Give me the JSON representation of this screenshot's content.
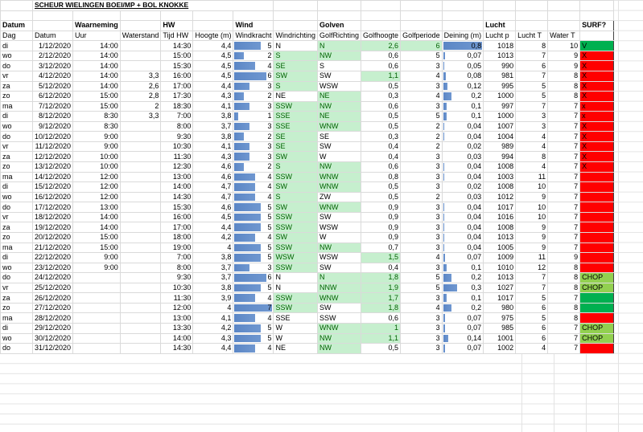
{
  "title": "SCHEUR WIELINGEN BOEI/MP + BOL KNOKKE",
  "groups": {
    "datum": "Datum",
    "waarneming": "Waarneming",
    "hw": "HW",
    "wind": "Wind",
    "golven": "Golven",
    "lucht": "Lucht",
    "surf": "SURF?"
  },
  "headers": [
    "Dag",
    "Datum",
    "Uur",
    "Waterstand",
    "Tijd HW",
    "Hoogte (m)",
    "Windkracht",
    "Windrichting",
    "GolfRichting",
    "Golfhoogte",
    "Golfperiode",
    "Deining (m)",
    "Lucht p",
    "Lucht T",
    "Water T",
    ""
  ],
  "colors": {
    "bar": "#638ec6",
    "highlight_bg": "#c6efce",
    "highlight_text": "#006100",
    "surf_yes": "#00b050",
    "surf_no": "#ff0000",
    "surf_chop": "#92d050"
  },
  "rows": [
    {
      "c": [
        "di",
        "1/12/2020",
        "14:00",
        "",
        "14:30",
        "4,4",
        "5",
        "N",
        "N",
        "2,6",
        "6",
        "0,8",
        "1018",
        "8",
        "10",
        "V"
      ],
      "hl": [
        8,
        9,
        10
      ],
      "s": "yes"
    },
    {
      "c": [
        "wo",
        "2/12/2020",
        "14:00",
        "",
        "15:00",
        "4,5",
        "2",
        "S",
        "NW",
        "0,6",
        "5",
        "0,07",
        "1013",
        "7",
        "9",
        "X"
      ],
      "hl": [
        7,
        8
      ],
      "s": "no"
    },
    {
      "c": [
        "do",
        "3/12/2020",
        "14:00",
        "",
        "15:30",
        "4,5",
        "4",
        "SE",
        "S",
        "0,6",
        "3",
        "0,05",
        "990",
        "6",
        "9",
        "X"
      ],
      "hl": [
        7
      ],
      "s": "no"
    },
    {
      "c": [
        "vr",
        "4/12/2020",
        "14:00",
        "3,3",
        "16:00",
        "4,5",
        "6",
        "SW",
        "SW",
        "1,1",
        "4",
        "0,08",
        "981",
        "7",
        "8",
        "X"
      ],
      "hl": [
        7,
        9
      ],
      "s": "no"
    },
    {
      "c": [
        "za",
        "5/12/2020",
        "14:00",
        "2,6",
        "17:00",
        "4,4",
        "3",
        "S",
        "WSW",
        "0,5",
        "3",
        "0,12",
        "995",
        "5",
        "8",
        "X"
      ],
      "hl": [
        7
      ],
      "s": "no"
    },
    {
      "c": [
        "zo",
        "6/12/2020",
        "15:00",
        "2,8",
        "17:30",
        "4,3",
        "2",
        "NE",
        "NE",
        "0,3",
        "4",
        "0,2",
        "1000",
        "5",
        "8",
        "X"
      ],
      "hl": [
        8
      ],
      "s": "no"
    },
    {
      "c": [
        "ma",
        "7/12/2020",
        "15:00",
        "2",
        "18:30",
        "4,1",
        "3",
        "SSW",
        "NW",
        "0,6",
        "3",
        "0,1",
        "997",
        "7",
        "7",
        "x"
      ],
      "hl": [
        7,
        8
      ],
      "s": "no"
    },
    {
      "c": [
        "di",
        "8/12/2020",
        "8:30",
        "3,3",
        "7:00",
        "3,8",
        "1",
        "SSE",
        "NE",
        "0,5",
        "5",
        "0,1",
        "1000",
        "3",
        "7",
        "x"
      ],
      "hl": [
        7,
        8
      ],
      "s": "no"
    },
    {
      "c": [
        "wo",
        "9/12/2020",
        "8:30",
        "",
        "8:00",
        "3,7",
        "3",
        "SSE",
        "WNW",
        "0,5",
        "2",
        "0,04",
        "1007",
        "3",
        "7",
        "X"
      ],
      "hl": [
        7,
        8
      ],
      "s": "no"
    },
    {
      "c": [
        "do",
        "10/12/2020",
        "9:00",
        "",
        "9:30",
        "3,8",
        "2",
        "SE",
        "SE",
        "0,3",
        "2",
        "0,04",
        "1004",
        "4",
        "7",
        "X"
      ],
      "hl": [
        7
      ],
      "s": "no"
    },
    {
      "c": [
        "vr",
        "11/12/2020",
        "9:00",
        "",
        "10:30",
        "4,1",
        "3",
        "SE",
        "SW",
        "0,4",
        "2",
        "0,02",
        "989",
        "4",
        "7",
        "X"
      ],
      "hl": [
        7
      ],
      "s": "no"
    },
    {
      "c": [
        "za",
        "12/12/2020",
        "10:00",
        "",
        "11:30",
        "4,3",
        "3",
        "SW",
        "W",
        "0,4",
        "3",
        "0,03",
        "994",
        "8",
        "7",
        "X"
      ],
      "hl": [
        7
      ],
      "s": "no"
    },
    {
      "c": [
        "zo",
        "13/12/2020",
        "10:00",
        "",
        "12:30",
        "4,6",
        "2",
        "S",
        "NW",
        "0,6",
        "3",
        "0,04",
        "1008",
        "4",
        "7",
        "X"
      ],
      "hl": [
        7,
        8
      ],
      "s": "no"
    },
    {
      "c": [
        "ma",
        "14/12/2020",
        "12:00",
        "",
        "13:00",
        "4,6",
        "4",
        "SSW",
        "WNW",
        "0,8",
        "3",
        "0,04",
        "1003",
        "11",
        "7",
        ""
      ],
      "hl": [
        7,
        8
      ],
      "s": "no"
    },
    {
      "c": [
        "di",
        "15/12/2020",
        "12:00",
        "",
        "14:00",
        "4,7",
        "4",
        "SW",
        "WNW",
        "0,5",
        "3",
        "0,02",
        "1008",
        "10",
        "7",
        ""
      ],
      "hl": [
        7,
        8
      ],
      "s": "no"
    },
    {
      "c": [
        "wo",
        "16/12/2020",
        "12:00",
        "",
        "14:30",
        "4,7",
        "4",
        "S",
        "ZW",
        "0,5",
        "2",
        "0,03",
        "1012",
        "9",
        "7",
        ""
      ],
      "hl": [
        7
      ],
      "s": "no"
    },
    {
      "c": [
        "do",
        "17/12/2020",
        "13:00",
        "",
        "15:30",
        "4,6",
        "5",
        "SW",
        "WNW",
        "0,9",
        "3",
        "0,04",
        "1017",
        "10",
        "7",
        ""
      ],
      "hl": [
        7,
        8
      ],
      "s": "no"
    },
    {
      "c": [
        "vr",
        "18/12/2020",
        "14:00",
        "",
        "16:00",
        "4,5",
        "5",
        "SSW",
        "SW",
        "0,9",
        "3",
        "0,04",
        "1016",
        "10",
        "7",
        ""
      ],
      "hl": [
        7
      ],
      "s": "no"
    },
    {
      "c": [
        "za",
        "19/12/2020",
        "14:00",
        "",
        "17:00",
        "4,4",
        "5",
        "SSW",
        "WSW",
        "0,9",
        "3",
        "0,04",
        "1008",
        "9",
        "7",
        ""
      ],
      "hl": [
        7
      ],
      "s": "no"
    },
    {
      "c": [
        "zo",
        "20/12/2020",
        "15:00",
        "",
        "18:00",
        "4,2",
        "4",
        "SW",
        "W",
        "0,9",
        "3",
        "0,04",
        "1013",
        "9",
        "7",
        ""
      ],
      "hl": [
        7
      ],
      "s": "no"
    },
    {
      "c": [
        "ma",
        "21/12/2020",
        "15:00",
        "",
        "19:00",
        "4",
        "5",
        "SSW",
        "NW",
        "0,7",
        "3",
        "0,04",
        "1005",
        "9",
        "7",
        ""
      ],
      "hl": [
        7,
        8
      ],
      "s": "no"
    },
    {
      "c": [
        "di",
        "22/12/2020",
        "9:00",
        "",
        "7:00",
        "3,8",
        "5",
        "WSW",
        "WSW",
        "1,5",
        "4",
        "0,07",
        "1009",
        "11",
        "9",
        ""
      ],
      "hl": [
        7,
        9
      ],
      "s": "no"
    },
    {
      "c": [
        "wo",
        "23/12/2020",
        "9:00",
        "",
        "8:00",
        "3,7",
        "3",
        "SSW",
        "SW",
        "0,4",
        "3",
        "0,1",
        "1010",
        "12",
        "8",
        ""
      ],
      "hl": [
        7
      ],
      "s": "no"
    },
    {
      "c": [
        "do",
        "24/12/2020",
        "",
        "",
        "9:30",
        "3,7",
        "6",
        "N",
        "N",
        "1,8",
        "5",
        "0,2",
        "1013",
        "7",
        "8",
        "CHOP"
      ],
      "hl": [
        8,
        9
      ],
      "s": "chop"
    },
    {
      "c": [
        "vr",
        "25/12/2020",
        "",
        "",
        "10:30",
        "3,8",
        "5",
        "N",
        "NNW",
        "1,9",
        "5",
        "0,3",
        "1027",
        "7",
        "8",
        "CHOP"
      ],
      "hl": [
        8,
        9
      ],
      "s": "chop"
    },
    {
      "c": [
        "za",
        "26/12/2020",
        "",
        "",
        "11:30",
        "3,9",
        "4",
        "SSW",
        "WNW",
        "1,7",
        "3",
        "0,1",
        "1017",
        "5",
        "7",
        ""
      ],
      "hl": [
        7,
        8,
        9
      ],
      "s": "yes"
    },
    {
      "c": [
        "zo",
        "27/12/2020",
        "",
        "",
        "12:00",
        "4",
        "7",
        "SSW",
        "SW",
        "1,8",
        "4",
        "0,2",
        "980",
        "6",
        "8",
        ""
      ],
      "hl": [
        7,
        9
      ],
      "s": "yes"
    },
    {
      "c": [
        "ma",
        "28/12/2020",
        "",
        "",
        "13:00",
        "4,1",
        "4",
        "SSE",
        "SSW",
        "0,6",
        "3",
        "0,07",
        "975",
        "5",
        "8",
        ""
      ],
      "hl": [],
      "s": "no"
    },
    {
      "c": [
        "di",
        "29/12/2020",
        "",
        "",
        "13:30",
        "4,2",
        "5",
        "W",
        "WNW",
        "1",
        "3",
        "0,07",
        "985",
        "6",
        "7",
        "CHOP"
      ],
      "hl": [
        8,
        9
      ],
      "s": "chop"
    },
    {
      "c": [
        "wo",
        "30/12/2020",
        "",
        "",
        "14:00",
        "4,3",
        "5",
        "W",
        "NW",
        "1,1",
        "3",
        "0,14",
        "1001",
        "6",
        "7",
        "CHOP"
      ],
      "hl": [
        8,
        9
      ],
      "s": "chop"
    },
    {
      "c": [
        "do",
        "31/12/2020",
        "",
        "",
        "14:30",
        "4,4",
        "4",
        "NE",
        "NW",
        "0,5",
        "3",
        "0,07",
        "1002",
        "4",
        "7",
        ""
      ],
      "hl": [
        8
      ],
      "s": "no"
    }
  ]
}
